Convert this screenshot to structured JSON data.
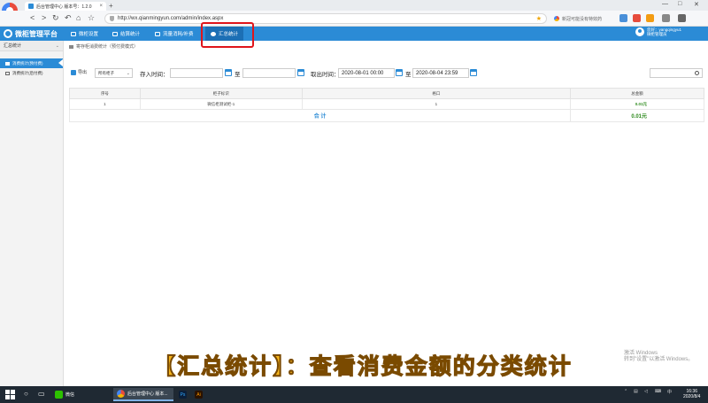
{
  "browser": {
    "tab_title": "后台管理中心 版本号：1.2.0",
    "tab_close": "×",
    "new_tab": "+",
    "url": "http://wx.qianmingyun.com/admin/index.aspx",
    "search_hint": "新冠可能没有特效药",
    "nav_back": "<",
    "nav_forward": ">",
    "nav_refresh": "↻",
    "nav_undo": "↶",
    "nav_home": "⌂",
    "nav_star": "☆",
    "star": "★",
    "win_min": "—",
    "win_max": "□",
    "win_close": "✕"
  },
  "app": {
    "logo_text": "微柜管理平台",
    "nav": [
      {
        "label": "微柜设置"
      },
      {
        "label": "结算统计"
      },
      {
        "label": "流量消耗/补费"
      },
      {
        "label": "汇总统计"
      }
    ],
    "user_line1": "您好：yangqingyu1",
    "user_line2": "微柜管理员"
  },
  "sidebar": {
    "header": "汇总统计",
    "items": [
      {
        "label": "消费统计(预付费)"
      },
      {
        "label": "消费统计(后付费)"
      }
    ]
  },
  "breadcrumb": "寄存柜消费统计（预付费模式）",
  "filters": {
    "export_label": "导出",
    "cabinet_select": "所有柜子",
    "store_time_label": "存入时间：",
    "to_label": "至",
    "pickup_time_label": "取出时间：",
    "pickup_from": "2020-08-01 00:00",
    "pickup_to": "2020-08-04 23:59",
    "store_from": "",
    "store_to": "",
    "search_value": ""
  },
  "table": {
    "headers": [
      "序号",
      "柜子标识",
      "格口",
      "总金额"
    ],
    "rows": [
      {
        "index": "1",
        "cabinet": "微信柜测试柜-1",
        "slot": "1",
        "amount": "0.01元"
      }
    ],
    "total_label": "合 计",
    "total_amount": "0.01元"
  },
  "caption": "【汇总统计】：查看消费金额的分类统计",
  "watermark": {
    "line1": "激活 Windows",
    "line2": "转到\"设置\"以激活 Windows。"
  },
  "taskbar": {
    "apps": [
      {
        "label": "微信"
      },
      {
        "label": "后台管理中心 版本..."
      },
      {
        "label": "Ps"
      },
      {
        "label": "Ai"
      }
    ],
    "time": "16:36",
    "date": "2020/8/4"
  },
  "colors": {
    "accent": "#2b8bd6",
    "highlight": "#e0151b",
    "caption": "#f6b51c"
  }
}
